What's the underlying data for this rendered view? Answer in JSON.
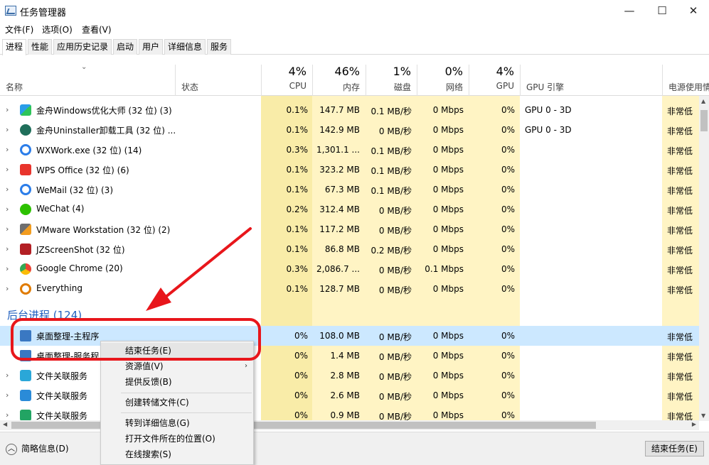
{
  "window": {
    "title": "任务管理器",
    "minimize": "—",
    "maximize": "☐",
    "close": "✕"
  },
  "menu": [
    "文件(F)",
    "选项(O)",
    "查看(V)"
  ],
  "tabs": [
    "进程",
    "性能",
    "应用历史记录",
    "启动",
    "用户",
    "详细信息",
    "服务"
  ],
  "columns": {
    "name": "名称",
    "status": "状态",
    "cpu": {
      "pct": "4%",
      "label": "CPU"
    },
    "mem": {
      "pct": "46%",
      "label": "内存"
    },
    "disk": {
      "pct": "1%",
      "label": "磁盘"
    },
    "net": {
      "pct": "0%",
      "label": "网络"
    },
    "gpu": {
      "pct": "4%",
      "label": "GPU"
    },
    "gpu_engine": "GPU 引擎",
    "power": "电源使用情"
  },
  "apps": [
    {
      "name": "金舟Windows优化大师 (32 位) (3)",
      "cpu": "0.1%",
      "mem": "147.7 MB",
      "disk": "0.1 MB/秒",
      "net": "0 Mbps",
      "gpu": "0%",
      "engine": "GPU 0 - 3D",
      "power": "非常低"
    },
    {
      "name": "金舟Uninstaller卸载工具 (32 位) ...",
      "cpu": "0.1%",
      "mem": "142.9 MB",
      "disk": "0 MB/秒",
      "net": "0 Mbps",
      "gpu": "0%",
      "engine": "GPU 0 - 3D",
      "power": "非常低"
    },
    {
      "name": "WXWork.exe (32 位) (14)",
      "cpu": "0.3%",
      "mem": "1,301.1 ...",
      "disk": "0.1 MB/秒",
      "net": "0 Mbps",
      "gpu": "0%",
      "engine": "",
      "power": "非常低"
    },
    {
      "name": "WPS Office (32 位) (6)",
      "cpu": "0.1%",
      "mem": "323.2 MB",
      "disk": "0.1 MB/秒",
      "net": "0 Mbps",
      "gpu": "0%",
      "engine": "",
      "power": "非常低"
    },
    {
      "name": "WeMail (32 位) (3)",
      "cpu": "0.1%",
      "mem": "67.3 MB",
      "disk": "0.1 MB/秒",
      "net": "0 Mbps",
      "gpu": "0%",
      "engine": "",
      "power": "非常低"
    },
    {
      "name": "WeChat (4)",
      "cpu": "0.2%",
      "mem": "312.4 MB",
      "disk": "0 MB/秒",
      "net": "0 Mbps",
      "gpu": "0%",
      "engine": "",
      "power": "非常低"
    },
    {
      "name": "VMware Workstation (32 位) (2)",
      "cpu": "0.1%",
      "mem": "117.2 MB",
      "disk": "0 MB/秒",
      "net": "0 Mbps",
      "gpu": "0%",
      "engine": "",
      "power": "非常低"
    },
    {
      "name": "JZScreenShot (32 位)",
      "cpu": "0.1%",
      "mem": "86.8 MB",
      "disk": "0.2 MB/秒",
      "net": "0 Mbps",
      "gpu": "0%",
      "engine": "",
      "power": "非常低"
    },
    {
      "name": "Google Chrome (20)",
      "cpu": "0.3%",
      "mem": "2,086.7 ...",
      "disk": "0 MB/秒",
      "net": "0.1 Mbps",
      "gpu": "0%",
      "engine": "",
      "power": "非常低"
    },
    {
      "name": "Everything",
      "cpu": "0.1%",
      "mem": "128.7 MB",
      "disk": "0 MB/秒",
      "net": "0 Mbps",
      "gpu": "0%",
      "engine": "",
      "power": "非常低"
    }
  ],
  "bg_group": "后台进程 (124)",
  "bg": [
    {
      "name": "桌面整理-主程序",
      "cpu": "0%",
      "mem": "108.0 MB",
      "disk": "0 MB/秒",
      "net": "0 Mbps",
      "gpu": "0%",
      "power": "非常低"
    },
    {
      "name": "桌面整理-服务程",
      "cpu": "0%",
      "mem": "1.4 MB",
      "disk": "0 MB/秒",
      "net": "0 Mbps",
      "gpu": "0%",
      "power": "非常低"
    },
    {
      "name": "文件关联服务",
      "cpu": "0%",
      "mem": "2.8 MB",
      "disk": "0 MB/秒",
      "net": "0 Mbps",
      "gpu": "0%",
      "power": "非常低"
    },
    {
      "name": "文件关联服务",
      "cpu": "0%",
      "mem": "2.6 MB",
      "disk": "0 MB/秒",
      "net": "0 Mbps",
      "gpu": "0%",
      "power": "非常低"
    },
    {
      "name": "文件关联服务",
      "cpu": "0%",
      "mem": "0.9 MB",
      "disk": "0 MB/秒",
      "net": "0 Mbps",
      "gpu": "0%",
      "power": "非常低"
    }
  ],
  "context_menu": [
    "结束任务(E)",
    "资源值(V)",
    "提供反馈(B)",
    "创建转储文件(C)",
    "转到详细信息(G)",
    "打开文件所在的位置(O)",
    "在线搜索(S)"
  ],
  "footer": {
    "fewer_details": "简略信息(D)",
    "end_task": "结束任务(E)"
  },
  "colors": {
    "highlight_col": "#fff4c4",
    "highlight_strong": "#f9eca8",
    "selection": "#cce8ff",
    "annotation_red": "#e8161b",
    "group_blue": "#1f5fbf"
  }
}
